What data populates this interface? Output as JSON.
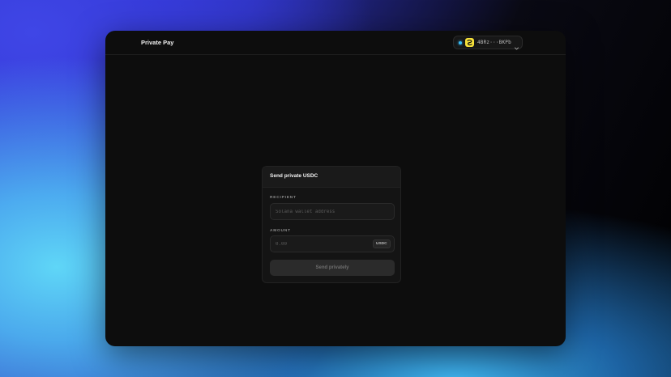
{
  "app": {
    "title": "Private Pay"
  },
  "wallet": {
    "address": "4BRz···BKPb",
    "status_color": "#38bdf8",
    "logo_color": "#f7e23b",
    "icon": "chevron-down-icon"
  },
  "form": {
    "title": "Send private USDC",
    "recipient": {
      "label": "RECIPIENT",
      "placeholder": "Solana wallet address",
      "value": ""
    },
    "amount": {
      "label": "AMOUNT",
      "placeholder": "0.00",
      "value": "",
      "unit": "USDC"
    },
    "submit_label": "Send privately"
  }
}
